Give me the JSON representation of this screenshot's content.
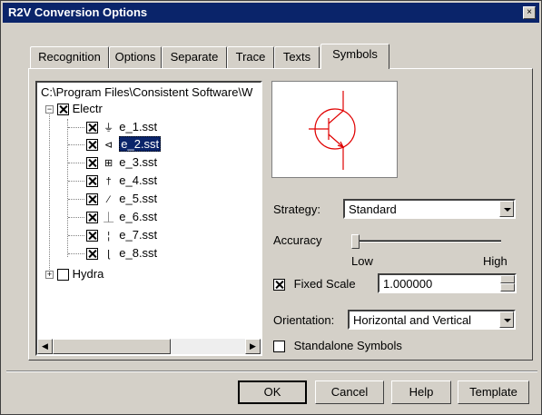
{
  "window": {
    "title": "R2V Conversion Options",
    "close_glyph": "×"
  },
  "tabs": [
    {
      "label": "Recognition"
    },
    {
      "label": "Options"
    },
    {
      "label": "Separate"
    },
    {
      "label": "Trace"
    },
    {
      "label": "Texts"
    },
    {
      "label": "Symbols"
    }
  ],
  "active_tab": "Symbols",
  "tree": {
    "path": "C:\\Program Files\\Consistent Software\\W",
    "groups": [
      {
        "label": "Electr",
        "expanded": true,
        "checked": true,
        "items": [
          "e_1.sst",
          "e_2.sst",
          "e_3.sst",
          "e_4.sst",
          "e_5.sst",
          "e_6.sst",
          "e_7.sst",
          "e_8.sst"
        ],
        "selected": "e_2.sst"
      },
      {
        "label": "Hydra",
        "expanded": false,
        "checked": false
      }
    ]
  },
  "strategy": {
    "label": "Strategy:",
    "value": "Standard"
  },
  "accuracy": {
    "label": "Accuracy",
    "low": "Low",
    "high": "High",
    "level": 0.0
  },
  "fixed_scale": {
    "label": "Fixed Scale",
    "checked": true,
    "value": "1.000000"
  },
  "orientation": {
    "label": "Orientation:",
    "value": "Horizontal and Vertical"
  },
  "standalone": {
    "label": "Standalone Symbols",
    "checked": false
  },
  "buttons": {
    "ok": "OK",
    "cancel": "Cancel",
    "help": "Help",
    "template": "Template"
  },
  "colors": {
    "titlebar": "#0a246a",
    "symbol": "#e00000",
    "face": "#d4d0c8"
  }
}
